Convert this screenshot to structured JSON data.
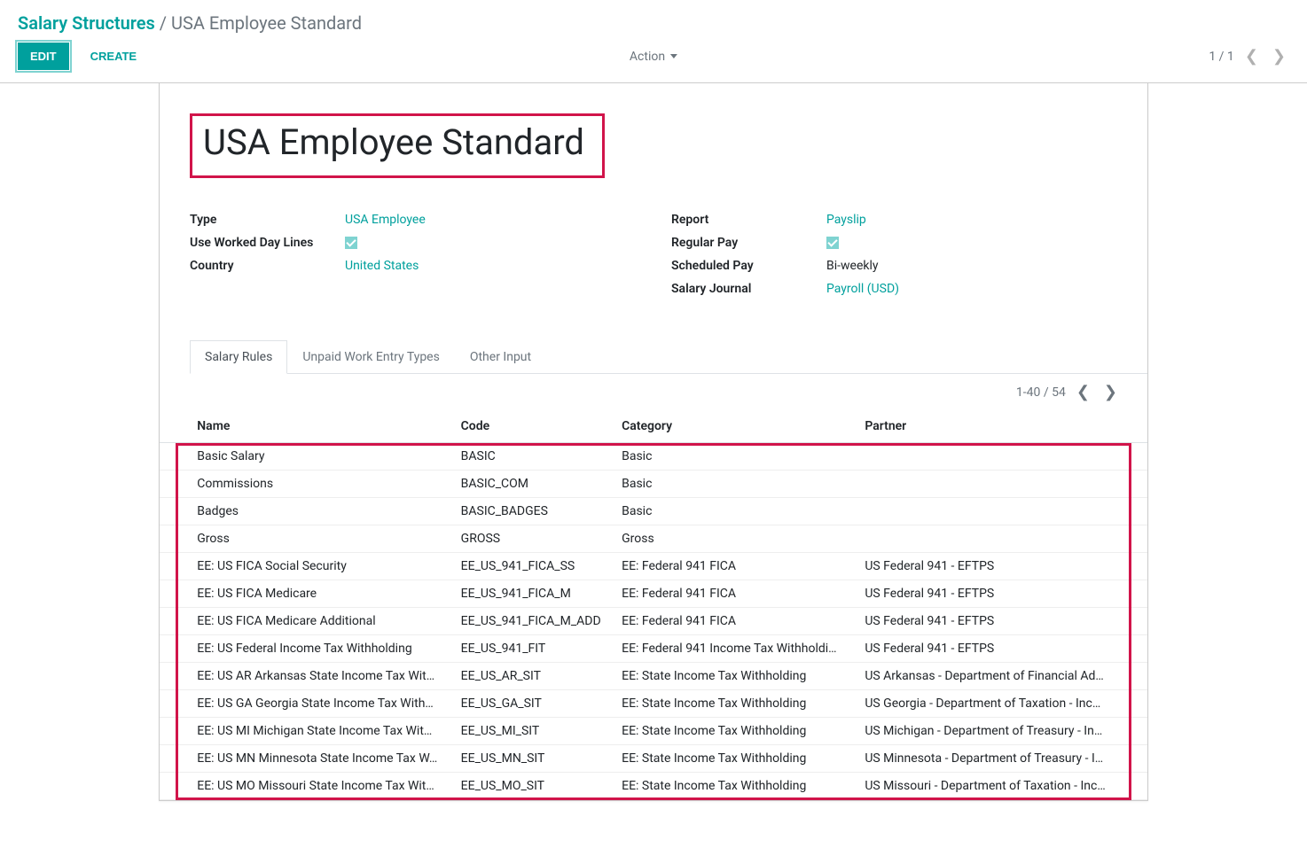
{
  "breadcrumb": {
    "parent": "Salary Structures",
    "separator": "/",
    "current": "USA Employee Standard"
  },
  "toolbar": {
    "edit_label": "EDIT",
    "create_label": "CREATE",
    "action_label": "Action",
    "pager": "1 / 1"
  },
  "title": "USA Employee Standard",
  "fields_left": [
    {
      "label": "Type",
      "value": "USA Employee",
      "link": true
    },
    {
      "label": "Use Worked Day Lines",
      "value": "",
      "checkbox": true
    },
    {
      "label": "Country",
      "value": "United States",
      "link": true
    }
  ],
  "fields_right": [
    {
      "label": "Report",
      "value": "Payslip",
      "link": true
    },
    {
      "label": "Regular Pay",
      "value": "",
      "checkbox": true
    },
    {
      "label": "Scheduled Pay",
      "value": "Bi-weekly",
      "link": false
    },
    {
      "label": "Salary Journal",
      "value": "Payroll (USD)",
      "link": true
    }
  ],
  "tabs": [
    {
      "label": "Salary Rules",
      "active": true
    },
    {
      "label": "Unpaid Work Entry Types",
      "active": false
    },
    {
      "label": "Other Input",
      "active": false
    }
  ],
  "table_pager": "1-40 / 54",
  "columns": {
    "name": "Name",
    "code": "Code",
    "category": "Category",
    "partner": "Partner"
  },
  "rows": [
    {
      "name": "Basic Salary",
      "code": "BASIC",
      "category": "Basic",
      "partner": ""
    },
    {
      "name": "Commissions",
      "code": "BASIC_COM",
      "category": "Basic",
      "partner": ""
    },
    {
      "name": "Badges",
      "code": "BASIC_BADGES",
      "category": "Basic",
      "partner": ""
    },
    {
      "name": "Gross",
      "code": "GROSS",
      "category": "Gross",
      "partner": ""
    },
    {
      "name": "EE: US FICA Social Security",
      "code": "EE_US_941_FICA_SS",
      "category": "EE: Federal 941 FICA",
      "partner": "US Federal 941 - EFTPS"
    },
    {
      "name": "EE: US FICA Medicare",
      "code": "EE_US_941_FICA_M",
      "category": "EE: Federal 941 FICA",
      "partner": "US Federal 941 - EFTPS"
    },
    {
      "name": "EE: US FICA Medicare Additional",
      "code": "EE_US_941_FICA_M_ADD",
      "category": "EE: Federal 941 FICA",
      "partner": "US Federal 941 - EFTPS"
    },
    {
      "name": "EE: US Federal Income Tax Withholding",
      "code": "EE_US_941_FIT",
      "category": "EE: Federal 941 Income Tax Withholdi…",
      "partner": "US Federal 941 - EFTPS"
    },
    {
      "name": "EE: US AR Arkansas State Income Tax Wit…",
      "code": "EE_US_AR_SIT",
      "category": "EE: State Income Tax Withholding",
      "partner": "US Arkansas - Department of Financial Ad…"
    },
    {
      "name": "EE: US GA Georgia State Income Tax With…",
      "code": "EE_US_GA_SIT",
      "category": "EE: State Income Tax Withholding",
      "partner": "US Georgia - Department of Taxation - Inc…"
    },
    {
      "name": "EE: US MI Michigan State Income Tax Wit…",
      "code": "EE_US_MI_SIT",
      "category": "EE: State Income Tax Withholding",
      "partner": "US Michigan - Department of Treasury - In…"
    },
    {
      "name": "EE: US MN Minnesota State Income Tax W…",
      "code": "EE_US_MN_SIT",
      "category": "EE: State Income Tax Withholding",
      "partner": "US Minnesota - Department of Treasury - I…"
    },
    {
      "name": "EE: US MO Missouri State Income Tax Wit…",
      "code": "EE_US_MO_SIT",
      "category": "EE: State Income Tax Withholding",
      "partner": "US Missouri - Department of Taxation - Inc…"
    }
  ]
}
